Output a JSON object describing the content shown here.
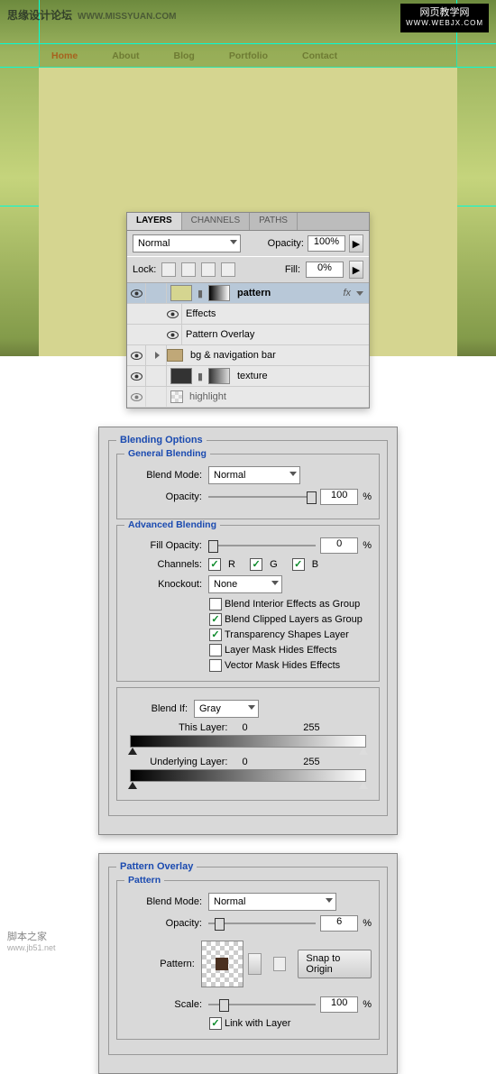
{
  "watermark_tl": {
    "text": "思缘设计论坛",
    "url": "WWW.MISSYUAN.COM"
  },
  "watermark_tr": {
    "line1": "网页教学网",
    "line2": "WWW.WEBJX.COM"
  },
  "watermark_bl": {
    "text": "脚本之家",
    "url": "www.jb51.net"
  },
  "nav": [
    "Home",
    "About",
    "Blog",
    "Portfolio",
    "Contact"
  ],
  "layers_panel": {
    "tabs": [
      "LAYERS",
      "CHANNELS",
      "PATHS"
    ],
    "blend_mode": "Normal",
    "opacity_label": "Opacity:",
    "opacity": "100%",
    "lock_label": "Lock:",
    "fill_label": "Fill:",
    "fill": "0%",
    "layers": {
      "pattern": "pattern",
      "effects": "Effects",
      "pattern_overlay": "Pattern Overlay",
      "bg_nav": "bg & navigation bar",
      "texture": "texture",
      "highlight": "highlight",
      "fx": "fx"
    }
  },
  "blending": {
    "title": "Blending Options",
    "general": {
      "title": "General Blending",
      "blend_mode_label": "Blend Mode:",
      "blend_mode": "Normal",
      "opacity_label": "Opacity:",
      "opacity": "100",
      "pct": "%"
    },
    "advanced": {
      "title": "Advanced Blending",
      "fill_label": "Fill Opacity:",
      "fill": "0",
      "channels_label": "Channels:",
      "r": "R",
      "g": "G",
      "b": "B",
      "knockout_label": "Knockout:",
      "knockout": "None",
      "opt1": "Blend Interior Effects as Group",
      "opt2": "Blend Clipped Layers as Group",
      "opt3": "Transparency Shapes Layer",
      "opt4": "Layer Mask Hides Effects",
      "opt5": "Vector Mask Hides Effects"
    },
    "blendif": {
      "label": "Blend If:",
      "value": "Gray",
      "this": "This Layer:",
      "under": "Underlying Layer:",
      "v0": "0",
      "v255": "255"
    }
  },
  "po": {
    "title": "Pattern Overlay",
    "pattern": "Pattern",
    "blend_mode_label": "Blend Mode:",
    "blend_mode": "Normal",
    "opacity_label": "Opacity:",
    "opacity": "6",
    "pattern_label": "Pattern:",
    "snap": "Snap to Origin",
    "scale_label": "Scale:",
    "scale": "100",
    "link": "Link with Layer",
    "pct": "%"
  }
}
